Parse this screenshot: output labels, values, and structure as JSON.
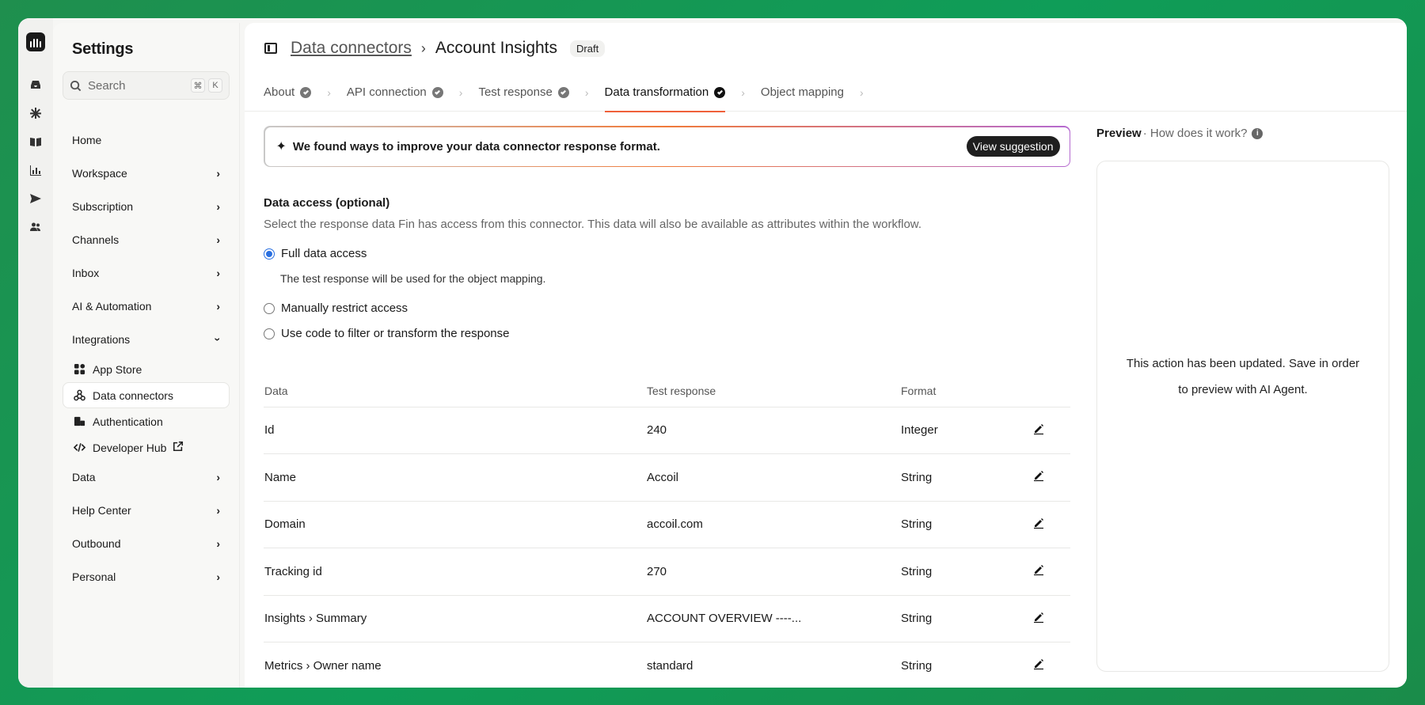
{
  "sidebar": {
    "title": "Settings",
    "search_placeholder": "Search",
    "shortcut_keys": [
      "⌘",
      "K"
    ],
    "items": [
      {
        "label": "Home",
        "expandable": false
      },
      {
        "label": "Workspace",
        "expandable": true
      },
      {
        "label": "Subscription",
        "expandable": true
      },
      {
        "label": "Channels",
        "expandable": true
      },
      {
        "label": "Inbox",
        "expandable": true
      },
      {
        "label": "AI & Automation",
        "expandable": true
      },
      {
        "label": "Integrations",
        "expandable": true,
        "expanded": true
      }
    ],
    "integrations_sub": [
      {
        "label": "App Store",
        "icon": "grid-icon"
      },
      {
        "label": "Data connectors",
        "icon": "webhook-icon",
        "active": true
      },
      {
        "label": "Authentication",
        "icon": "auth-icon"
      },
      {
        "label": "Developer Hub",
        "icon": "code-icon",
        "external": true
      }
    ],
    "items_after": [
      {
        "label": "Data"
      },
      {
        "label": "Help Center"
      },
      {
        "label": "Outbound"
      },
      {
        "label": "Personal"
      }
    ]
  },
  "header": {
    "breadcrumb_link": "Data connectors",
    "current": "Account Insights",
    "status_badge": "Draft"
  },
  "tabs": [
    {
      "label": "About",
      "done": true
    },
    {
      "label": "API connection",
      "done": true
    },
    {
      "label": "Test response",
      "done": true
    },
    {
      "label": "Data transformation",
      "done": true,
      "active": true
    },
    {
      "label": "Object mapping",
      "done": false
    }
  ],
  "banner": {
    "text": "We found ways to improve your data connector response format.",
    "button": "View suggestion"
  },
  "data_access": {
    "title": "Data access (optional)",
    "description": "Select the response data Fin has access from this connector. This data will also be available as attributes within the workflow.",
    "options": [
      {
        "label": "Full data access",
        "selected": true,
        "help": "The test response will be used for the object mapping."
      },
      {
        "label": "Manually restrict access",
        "selected": false
      },
      {
        "label": "Use code to filter or transform the response",
        "selected": false
      }
    ]
  },
  "table": {
    "headers": [
      "Data",
      "Test response",
      "Format"
    ],
    "rows": [
      {
        "data": "Id",
        "test_response": "240",
        "format": "Integer"
      },
      {
        "data": "Name",
        "test_response": "Accoil",
        "format": "String"
      },
      {
        "data": "Domain",
        "test_response": "accoil.com",
        "format": "String"
      },
      {
        "data": "Tracking id",
        "test_response": "270",
        "format": "String"
      },
      {
        "data": "Insights › Summary",
        "test_response": "ACCOUNT OVERVIEW ----...",
        "format": "String"
      },
      {
        "data": "Metrics › Owner name",
        "test_response": "standard",
        "format": "String"
      }
    ]
  },
  "preview": {
    "title": "Preview",
    "help_link": "· How does it work?",
    "message_line1": "This action has been updated. Save in order",
    "message_line2": "to preview with AI Agent."
  },
  "colors": {
    "accent_tab_underline": "#f0603a",
    "radio_selected": "#2a6fe0",
    "background_gradient": "#0f9d58"
  }
}
